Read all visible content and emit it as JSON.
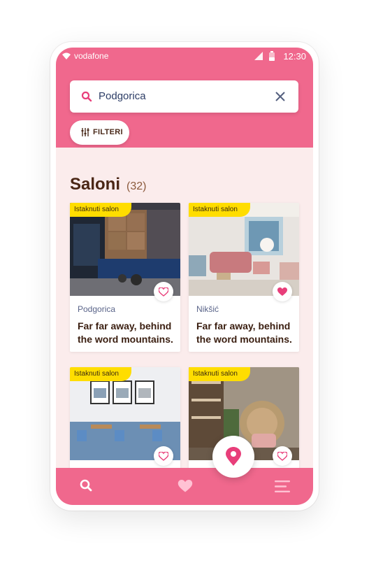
{
  "status_bar": {
    "carrier": "vodafone",
    "time": "12:30"
  },
  "search": {
    "value": "Podgorica"
  },
  "filter": {
    "label": "FILTERI"
  },
  "section": {
    "title": "Saloni",
    "count": "(32)"
  },
  "cards": [
    {
      "badge": "Istaknuti salon",
      "city": "Podgorica",
      "name": "Far far away, behind the word mountains.",
      "favorite": false
    },
    {
      "badge": "Istaknuti salon",
      "city": "Nikšić",
      "name": "Far far away, behind the word mountains.",
      "favorite": true
    },
    {
      "badge": "Istaknuti salon",
      "city": "",
      "name": "",
      "favorite": false
    },
    {
      "badge": "Istaknuti salon",
      "city": "",
      "name": "",
      "favorite": false
    }
  ],
  "colors": {
    "primary": "#f0688d",
    "background": "#fbecec",
    "badge": "#ffdd00",
    "heart": "#e83e7a"
  },
  "icons": {
    "search": "search-icon",
    "clear": "close-icon",
    "filter": "sliders-icon",
    "favorite": "heart-icon",
    "map": "map-pin-icon",
    "menu": "menu-icon"
  }
}
